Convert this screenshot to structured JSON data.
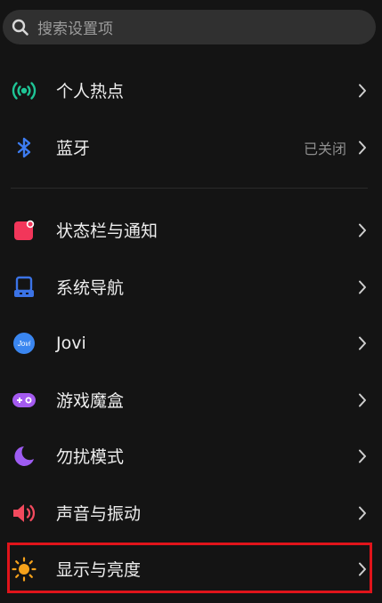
{
  "search": {
    "placeholder": "搜索设置项",
    "icon": "search-icon"
  },
  "items": [
    {
      "label": "个人热点",
      "icon": "hotspot-icon",
      "color": "#1fc596"
    },
    {
      "label": "蓝牙",
      "value": "已关闭",
      "icon": "bluetooth-icon",
      "color": "#3d7cf0"
    },
    {
      "label": "状态栏与通知",
      "icon": "notification-icon",
      "color": "#f2365a"
    },
    {
      "label": "系统导航",
      "icon": "navigation-icon",
      "color": "#3b73e6"
    },
    {
      "label": "Jovi",
      "icon": "jovi-icon",
      "color": "#3a86f0",
      "icon_text": "Jovi"
    },
    {
      "label": "游戏魔盒",
      "icon": "gamepad-icon",
      "color": "#a45af0"
    },
    {
      "label": "勿扰模式",
      "icon": "moon-icon",
      "color": "#9e5cf2"
    },
    {
      "label": "声音与振动",
      "icon": "speaker-icon",
      "color": "#f24a5e"
    },
    {
      "label": "显示与亮度",
      "icon": "sun-icon",
      "color": "#f5a21b",
      "highlighted": true
    }
  ]
}
